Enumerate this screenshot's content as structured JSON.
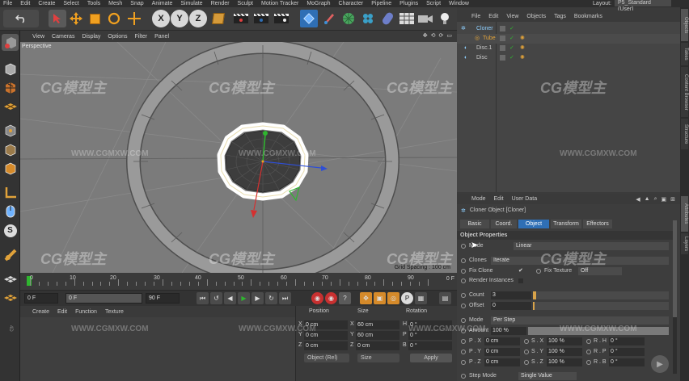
{
  "menubar": {
    "items": [
      "File",
      "Edit",
      "Create",
      "Select",
      "Tools",
      "Mesh",
      "Snap",
      "Animate",
      "Simulate",
      "Render",
      "Sculpt",
      "Motion Tracker",
      "MoGraph",
      "Character",
      "Pipeline",
      "Plugins",
      "Script",
      "Window"
    ],
    "layout_label": "Layout:",
    "layout_value": "P5_Standard (User)"
  },
  "viewport": {
    "menu": [
      "View",
      "Cameras",
      "Display",
      "Options",
      "Filter",
      "Panel"
    ],
    "label": "Perspective",
    "grid_spacing": "Grid Spacing : 100 cm"
  },
  "timeline": {
    "ticks": [
      "0",
      "10",
      "20",
      "30",
      "40",
      "50",
      "60",
      "70",
      "80",
      "90"
    ],
    "end": "0 F"
  },
  "playback": {
    "start": "0 F",
    "current": "0 F",
    "range_end": "90 F",
    "end": "90 F"
  },
  "material": {
    "menu": [
      "Create",
      "Edit",
      "Function",
      "Texture"
    ]
  },
  "coords": {
    "headers": [
      "Position",
      "Size",
      "Rotation"
    ],
    "rows": [
      {
        "ax": "X",
        "pos": "0 cm",
        "size_ax": "X",
        "size": "60 cm",
        "rot_ax": "H",
        "rot": "0 °"
      },
      {
        "ax": "Y",
        "pos": "0 cm",
        "size_ax": "Y",
        "size": "60 cm",
        "rot_ax": "P",
        "rot": "0 °"
      },
      {
        "ax": "Z",
        "pos": "0 cm",
        "size_ax": "Z",
        "size": "0 cm",
        "rot_ax": "B",
        "rot": "0 °"
      }
    ],
    "mode_drop": "Object (Rel)",
    "size_drop": "Size",
    "apply": "Apply"
  },
  "object_manager": {
    "menu": [
      "File",
      "Edit",
      "View",
      "Objects",
      "Tags",
      "Bookmarks"
    ],
    "objects": [
      {
        "name": "Cloner",
        "indent": 0,
        "color": "#8fd0ff"
      },
      {
        "name": "Tube",
        "indent": 1,
        "color": "#e0a23a"
      },
      {
        "name": "Disc.1",
        "indent": 0,
        "color": "#c8c8c8"
      },
      {
        "name": "Disc",
        "indent": 0,
        "color": "#c8c8c8"
      }
    ]
  },
  "attributes": {
    "menu": [
      "Mode",
      "Edit",
      "User Data"
    ],
    "title": "Cloner Object [Cloner]",
    "tabs": [
      "Basic",
      "Coord.",
      "Object",
      "Transform",
      "Effectors"
    ],
    "active_tab": "Object",
    "section": "Object Properties",
    "mode_label": "Mode",
    "mode_value": "Linear",
    "clones_label": "Clones",
    "clones_value": "Iterate",
    "fix_clone_label": "Fix Clone",
    "fix_texture_label": "Fix Texture",
    "fix_texture_value": "Off",
    "render_instances_label": "Render Instances",
    "count_label": "Count",
    "count_value": "3",
    "offset_label": "Offset",
    "offset_value": "0",
    "mode2_label": "Mode",
    "mode2_value": "Per Step",
    "amount_label": "Amount",
    "amount_value": "100 %",
    "p_rows": [
      {
        "a": "P . X",
        "av": "0 cm",
        "b": "S . X",
        "bv": "100 %",
        "c": "R . H",
        "cv": "0 °"
      },
      {
        "a": "P . Y",
        "av": "0 cm",
        "b": "S . Y",
        "bv": "100 %",
        "c": "R . P",
        "cv": "0 °"
      },
      {
        "a": "P . Z",
        "av": "0 cm",
        "b": "S . Z",
        "bv": "100 %",
        "c": "R . B",
        "cv": "0 °"
      }
    ],
    "step_mode_label": "Step Mode",
    "step_mode_value": "Single Value"
  },
  "rightstrip": [
    "Objects",
    "Takes",
    "Content Browser",
    "Structure",
    "Attributes",
    "Layers"
  ],
  "watermark": {
    "brand": "CG模型主",
    "url": "WWW.CGMXW.COM"
  },
  "colors": {
    "accent": "#2f6fb5",
    "viewport_bg": "#7b7b7b",
    "selected_ring": "#ffffff"
  }
}
